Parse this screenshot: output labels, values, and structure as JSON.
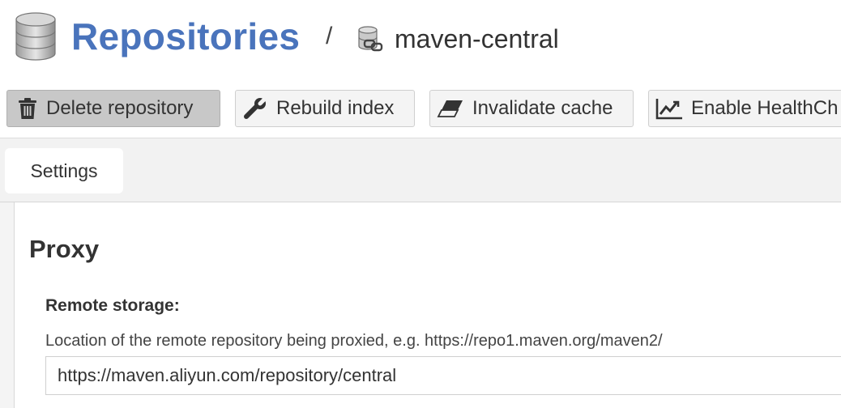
{
  "header": {
    "title": "Repositories",
    "separator": "/",
    "repository_name": "maven-central",
    "title_color": "#4a74bc",
    "icons": {
      "section": "database-icon",
      "repository": "proxy-repository-icon"
    }
  },
  "toolbar": {
    "buttons": [
      {
        "label": "Delete repository",
        "icon": "trash-icon",
        "active": true
      },
      {
        "label": "Rebuild index",
        "icon": "wrench-icon",
        "active": false
      },
      {
        "label": "Invalidate cache",
        "icon": "eraser-icon",
        "active": false
      },
      {
        "label": "Enable HealthCh",
        "icon": "health-chart-icon",
        "active": false
      }
    ]
  },
  "tabs": [
    {
      "label": "Settings",
      "selected": true
    }
  ],
  "proxy_section": {
    "title": "Proxy",
    "remote_storage": {
      "label": "Remote storage:",
      "help": "Location of the remote repository being proxied, e.g. https://repo1.maven.org/maven2/",
      "value": "https://maven.aliyun.com/repository/central"
    }
  }
}
